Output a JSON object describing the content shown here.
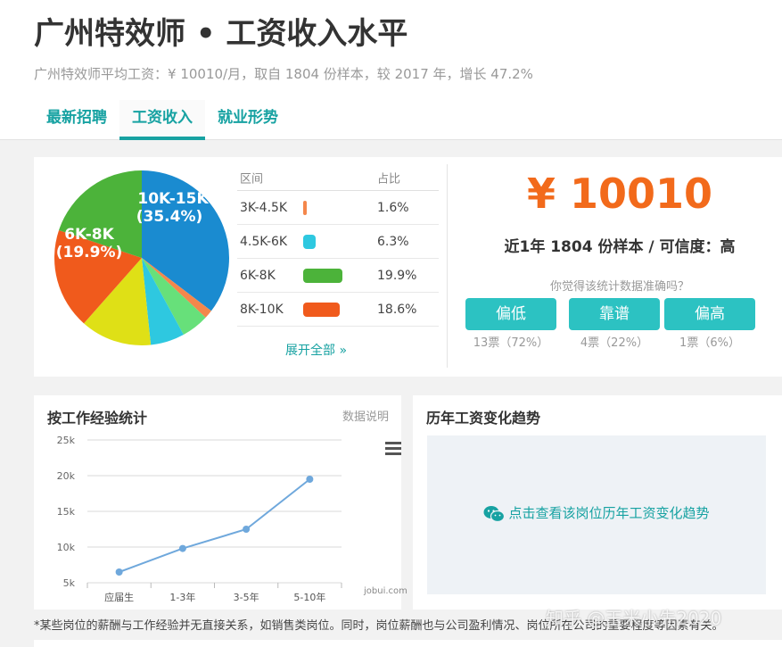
{
  "page": {
    "title": "广州特效师 • 工资收入水平",
    "subtitle": "广州特效师平均工资：¥ 10010/月，取自 1804 份样本，较 2017 年，增长 47.2%"
  },
  "tabs": [
    {
      "label": "最新招聘",
      "active": false
    },
    {
      "label": "工资收入",
      "active": true
    },
    {
      "label": "就业形势",
      "active": false
    }
  ],
  "distribution": {
    "headers": {
      "range": "区间",
      "share": "占比"
    },
    "rows": [
      {
        "range": "3K-4.5K",
        "share": "1.6%",
        "color": "#f4874b",
        "value": 1.6
      },
      {
        "range": "4.5K-6K",
        "share": "6.3%",
        "color": "#2ec8e0",
        "value": 6.3
      },
      {
        "range": "6K-8K",
        "share": "19.9%",
        "color": "#4cb33a",
        "value": 19.9
      },
      {
        "range": "8K-10K",
        "share": "18.6%",
        "color": "#f05a1c",
        "value": 18.6
      }
    ],
    "expand_label": "展开全部 »",
    "pie_labels": {
      "label_a": "10K-15K",
      "value_a": "(35.4%)",
      "label_b": "6K-8K",
      "value_b": "(19.9%)"
    }
  },
  "chart_data": [
    {
      "type": "pie",
      "labels": [
        "10K-15K",
        "3K-4.5K",
        "other",
        "4.5K-6K",
        "other",
        "8K-10K",
        "6K-8K"
      ],
      "values": [
        35.4,
        1.6,
        5.1,
        6.3,
        13.2,
        18.6,
        19.9
      ],
      "colors": [
        "#1a8bd0",
        "#f4874b",
        "#67e07a",
        "#2ec8e0",
        "#dfe016",
        "#f05a1c",
        "#4cb33a"
      ]
    },
    {
      "type": "line",
      "title": "按工作经验统计",
      "categories": [
        "应届生",
        "1-3年",
        "3-5年",
        "5-10年"
      ],
      "series": [
        {
          "values": [
            6.5,
            9.8,
            12.5,
            19.5
          ]
        }
      ],
      "y_tick_labels": [
        "5k",
        "10k",
        "15k",
        "20k",
        "25k"
      ],
      "ylim": [
        5,
        25
      ],
      "color": "#6fa8dc",
      "grid": true
    }
  ],
  "salary": {
    "amount": "¥ 10010",
    "sample_text": "近1年 1804 份样本 / 可信度：高",
    "question": "你觉得该统计数据准确吗？",
    "votes": [
      {
        "label": "偏低",
        "count": "13票（72%）"
      },
      {
        "label": "靠谱",
        "count": "4票（22%）"
      },
      {
        "label": "偏高",
        "count": "1票（6%）"
      }
    ]
  },
  "experience": {
    "title": "按工作经验统计",
    "note": "数据说明",
    "watermark": "jobui.com"
  },
  "trend": {
    "title": "历年工资变化趋势",
    "link": "点击查看该岗位历年工资变化趋势"
  },
  "footnote": "*某些岗位的薪酬与工作经验并无直接关系，如销售类岗位。同时，岗位薪酬也与公司盈利情况、岗位所在公司的重要程度等因素有关。",
  "watermark": "知乎 @玉米小先2020",
  "colors": {
    "accent": "#17a2a2",
    "salary": "#f26a1b",
    "button": "#2cc2c2"
  }
}
